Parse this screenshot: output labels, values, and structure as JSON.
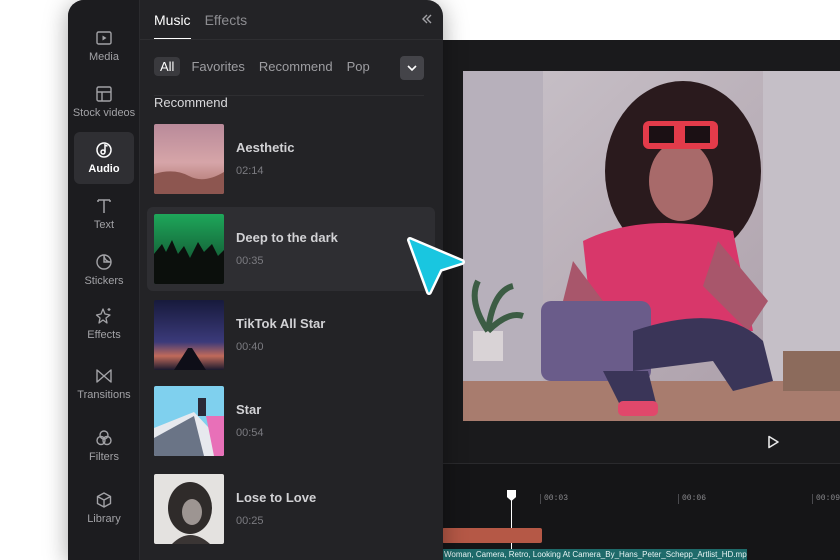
{
  "sidebar": {
    "items": [
      {
        "label": "Media",
        "icon": "media-icon"
      },
      {
        "label": "Stock videos",
        "icon": "stock-videos-icon"
      },
      {
        "label": "Audio",
        "icon": "audio-icon",
        "active": true
      },
      {
        "label": "Text",
        "icon": "text-icon"
      },
      {
        "label": "Stickers",
        "icon": "stickers-icon"
      },
      {
        "label": "Effects",
        "icon": "effects-icon"
      },
      {
        "label": "Transitions",
        "icon": "transitions-icon"
      },
      {
        "label": "Filters",
        "icon": "filters-icon"
      },
      {
        "label": "Library",
        "icon": "library-icon"
      }
    ]
  },
  "tabs": [
    {
      "label": "Music",
      "active": true
    },
    {
      "label": "Effects"
    }
  ],
  "chips": [
    {
      "label": "All",
      "active": true
    },
    {
      "label": "Favorites"
    },
    {
      "label": "Recommend"
    },
    {
      "label": "Pop"
    }
  ],
  "section_title": "Recommend",
  "tracks": [
    {
      "title": "Aesthetic",
      "duration": "02:14"
    },
    {
      "title": "Deep to the dark",
      "duration": "00:35",
      "hovered": true
    },
    {
      "title": "TikTok All Star",
      "duration": "00:40"
    },
    {
      "title": "Star",
      "duration": "00:54"
    },
    {
      "title": "Lose to Love",
      "duration": "00:25"
    }
  ],
  "timeline": {
    "ticks": [
      "00:03",
      "00:06",
      "00:09"
    ],
    "video_clip_name": "Woman, Camera, Retro, Looking At Camera_By_Hans_Peter_Schepp_Artlist_HD.mp"
  },
  "colors": {
    "panel_bg": "#232326",
    "sidebar_bg": "#1c1c1f",
    "cursor_accent": "#19c6e0",
    "audio_clip": "#b55846",
    "video_clip": "#1e6a6a"
  }
}
